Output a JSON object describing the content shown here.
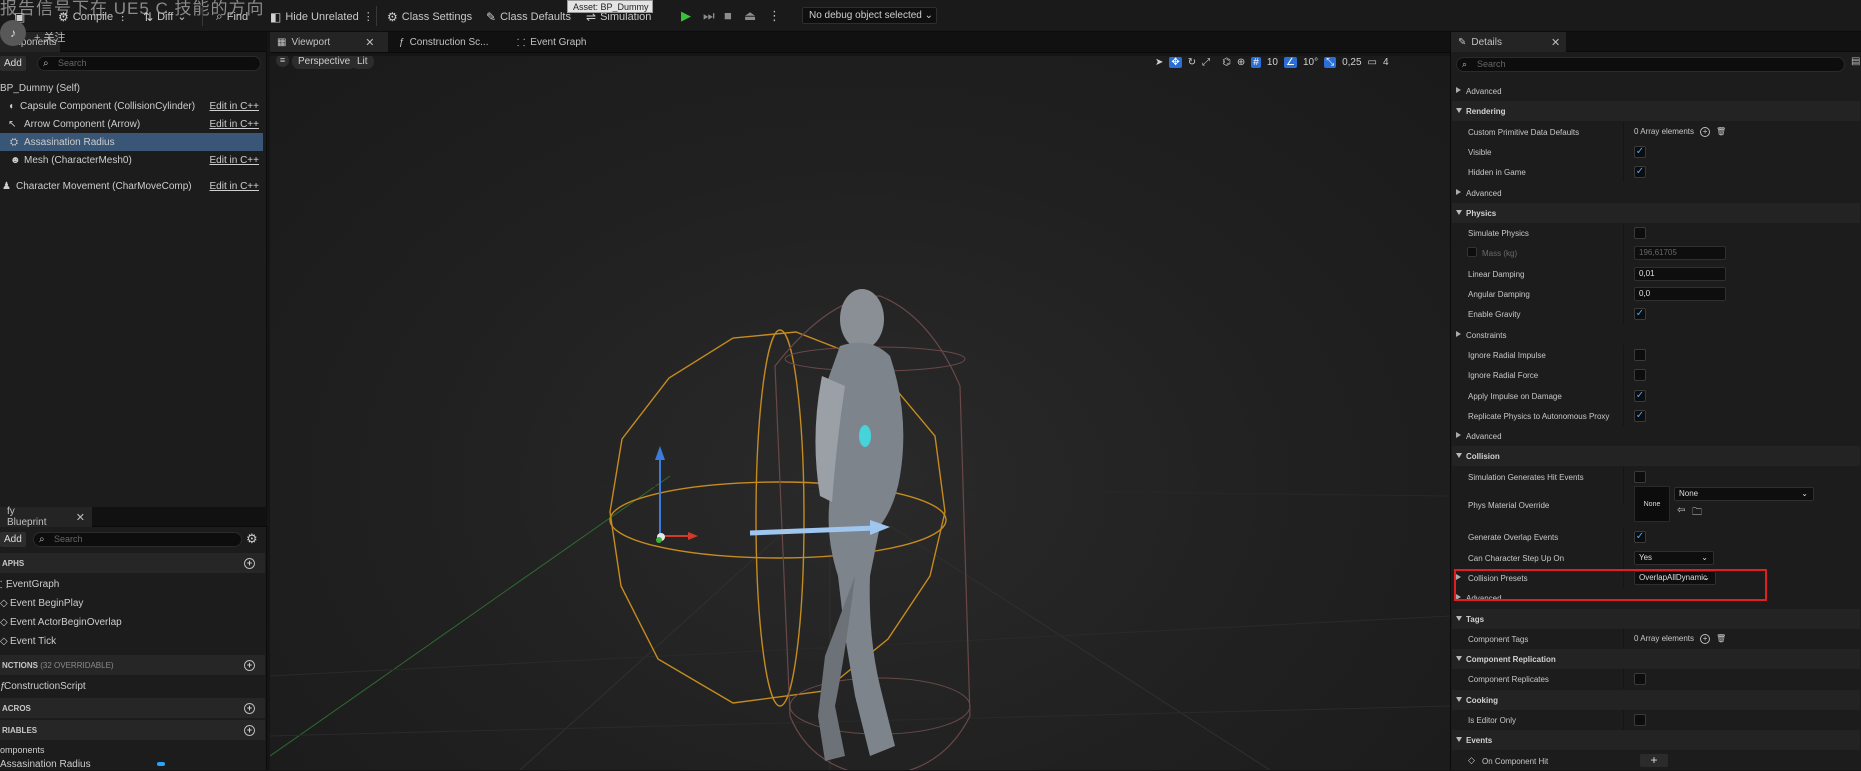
{
  "toolbar": {
    "overlay_text": "报告信号下在 UE5 C 技能的方向",
    "compile": "Compile",
    "diff": "Diff",
    "find": "Find",
    "hide_unrelated": "Hide Unrelated",
    "class_settings": "Class Settings",
    "class_defaults": "Class Defaults",
    "simulation": "Simulation",
    "tooltip": "Asset: BP_Dummy",
    "debug_object": "No debug object selected"
  },
  "watermark": {
    "follow": "+ 关注"
  },
  "components_panel": {
    "tab": "omponents",
    "add": "Add",
    "search_placeholder": "Search",
    "items": [
      {
        "label": "BP_Dummy (Self)",
        "edit": ""
      },
      {
        "label": "Capsule Component (CollisionCylinder)",
        "edit": "Edit in C++"
      },
      {
        "label": "Arrow Component (Arrow)",
        "edit": "Edit in C++"
      },
      {
        "label": "Assasination Radius",
        "edit": ""
      },
      {
        "label": "Mesh (CharacterMesh0)",
        "edit": "Edit in C++"
      },
      {
        "label": "Character Movement (CharMoveComp)",
        "edit": "Edit in C++"
      }
    ]
  },
  "my_blueprint": {
    "tab": "fy Blueprint",
    "add": "Add",
    "search_placeholder": "Search",
    "graphs_header": "APHS",
    "graphs": [
      "EventGraph",
      "Event BeginPlay",
      "Event ActorBeginOverlap",
      "Event Tick"
    ],
    "functions_header": "NCTIONS",
    "functions_count": "(32 OVERRIDABLE)",
    "functions": [
      "ConstructionScript"
    ],
    "macros_header": "ACROS",
    "variables_header": "RIABLES",
    "variables_sub": "omponents",
    "variables": [
      "Assasination Radius"
    ]
  },
  "editor_tabs": [
    "Viewport",
    "Construction Sc...",
    "Event Graph"
  ],
  "viewport": {
    "perspective": "Perspective",
    "lit": "Lit",
    "grid_snap": "10",
    "rot_snap": "10°",
    "scale_snap": "0,25",
    "camera_speed": "4"
  },
  "details": {
    "tab": "Details",
    "search_placeholder": "Search",
    "rows": [
      {
        "kind": "adv",
        "label": "Advanced"
      },
      {
        "kind": "head",
        "label": "Rendering"
      },
      {
        "kind": "arr",
        "label": "Custom Primitive Data Defaults",
        "value": "0 Array elements"
      },
      {
        "kind": "chk",
        "label": "Visible",
        "checked": true
      },
      {
        "kind": "chk",
        "label": "Hidden in Game",
        "checked": true
      },
      {
        "kind": "adv",
        "label": "Advanced"
      },
      {
        "kind": "head",
        "label": "Physics"
      },
      {
        "kind": "chk",
        "label": "Simulate Physics",
        "checked": false
      },
      {
        "kind": "mass",
        "label": "Mass (kg)",
        "value": "196,61705"
      },
      {
        "kind": "num",
        "label": "Linear Damping",
        "value": "0,01"
      },
      {
        "kind": "num",
        "label": "Angular Damping",
        "value": "0,0"
      },
      {
        "kind": "chk",
        "label": "Enable Gravity",
        "checked": true
      },
      {
        "kind": "adv",
        "label": "Constraints"
      },
      {
        "kind": "chk",
        "label": "Ignore Radial Impulse",
        "checked": false
      },
      {
        "kind": "chk",
        "label": "Ignore Radial Force",
        "checked": false
      },
      {
        "kind": "chk",
        "label": "Apply Impulse on Damage",
        "checked": true
      },
      {
        "kind": "chk",
        "label": "Replicate Physics to Autonomous Proxy",
        "checked": true
      },
      {
        "kind": "adv",
        "label": "Advanced"
      },
      {
        "kind": "head",
        "label": "Collision"
      },
      {
        "kind": "chk",
        "label": "Simulation Generates Hit Events",
        "checked": false
      },
      {
        "kind": "physmat",
        "label": "Phys Material Override",
        "value": "None",
        "thumb": "None"
      },
      {
        "kind": "chk",
        "label": "Generate Overlap Events",
        "checked": true
      },
      {
        "kind": "dd",
        "label": "Can Character Step Up On",
        "value": "Yes"
      },
      {
        "kind": "dd2",
        "label": "Collision Presets",
        "value": "OverlapAllDynamic"
      },
      {
        "kind": "adv",
        "label": "Advanced"
      },
      {
        "kind": "head",
        "label": "Tags"
      },
      {
        "kind": "arr",
        "label": "Component Tags",
        "value": "0 Array elements"
      },
      {
        "kind": "head",
        "label": "Component Replication"
      },
      {
        "kind": "chk",
        "label": "Component Replicates",
        "checked": false
      },
      {
        "kind": "head",
        "label": "Cooking"
      },
      {
        "kind": "chk",
        "label": "Is Editor Only",
        "checked": false
      },
      {
        "kind": "head",
        "label": "Events"
      },
      {
        "kind": "evt",
        "label": "On Component Hit"
      }
    ]
  }
}
